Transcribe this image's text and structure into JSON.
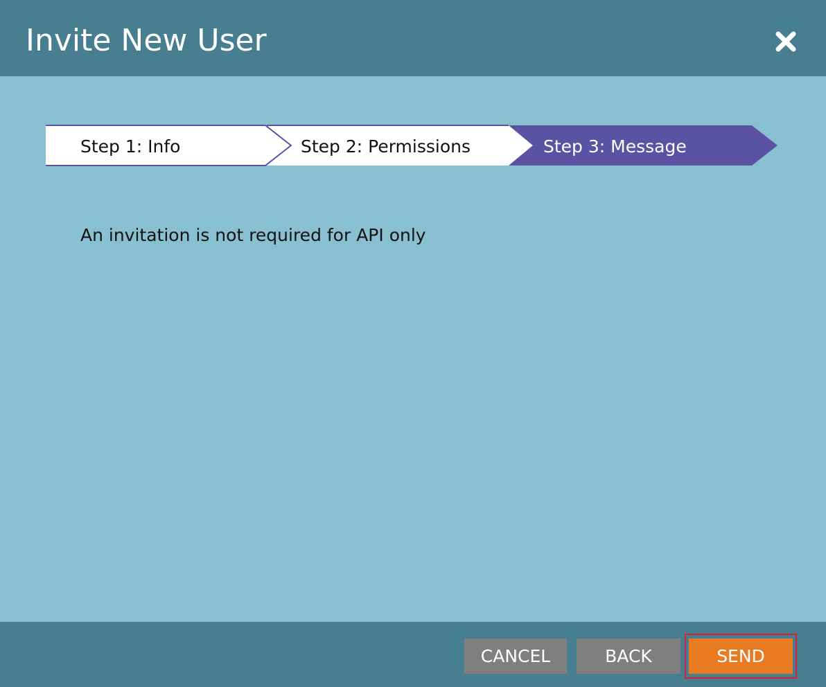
{
  "dialog": {
    "title": "Invite New User",
    "close_icon": "close-icon"
  },
  "steps": [
    {
      "label": "Step 1: Info",
      "state": "done"
    },
    {
      "label": "Step 2: Permissions",
      "state": "done"
    },
    {
      "label": "Step 3: Message",
      "state": "active"
    }
  ],
  "body": {
    "message": "An invitation is not required for API only"
  },
  "footer": {
    "cancel_label": "CANCEL",
    "back_label": "BACK",
    "send_label": "SEND"
  },
  "colors": {
    "header_bg": "#477f91",
    "body_bg": "#88c0d2",
    "step_active": "#5b52a3",
    "send_button": "#e87a22",
    "secondary_button": "#7f7f7f",
    "highlight_border": "#d6223c"
  }
}
